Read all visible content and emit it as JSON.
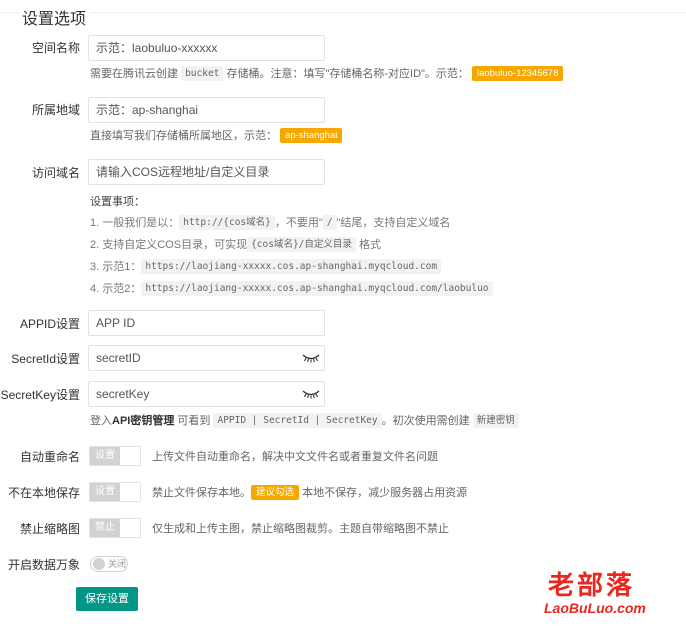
{
  "header": {
    "title": "设置选项"
  },
  "fields": {
    "space_name": {
      "label": "空间名称",
      "placeholder": "示范：laobuluo-xxxxxx",
      "hint_before": "需要在腾讯云创建",
      "hint_code": "bucket",
      "hint_after": "存储桶。注意：填写\"存储桶名称-对应ID\"。示范：",
      "hint_badge": "laobuluo-12345678"
    },
    "region": {
      "label": "所属地域",
      "placeholder": "示范：ap-shanghai",
      "hint_before": "直接填写我们存储桶所属地区，示范：",
      "hint_badge": "ap-shanghai"
    },
    "domain": {
      "label": "访问域名",
      "placeholder": "请输入COS远程地址/自定义目录"
    },
    "appid": {
      "label": "APPID设置",
      "placeholder": "APP ID"
    },
    "secret_id": {
      "label": "SecretId设置",
      "placeholder": "secretID"
    },
    "secret_key": {
      "label": "SecretKey设置",
      "placeholder": "secretKey",
      "hint_before": "登入",
      "hint_link": "API密钥管理",
      "hint_middle": "可看到",
      "hint_code": "APPID | SecretId | SecretKey",
      "hint_after": "。初次使用需创建",
      "hint_code2": "新建密钥"
    }
  },
  "notes": {
    "title": "设置事项：",
    "items": [
      {
        "prefix": "1. 一般我们是以：",
        "code": "http://{cos域名}",
        "middle": "，不要用\"",
        "code2": "/",
        "suffix": "\"结尾，支持自定义域名"
      },
      {
        "prefix": "2. 支持自定义COS目录，可实现",
        "code": "{cos域名}/自定义目录",
        "suffix": "格式"
      },
      {
        "prefix": "3. 示范1：",
        "code": "https://laojiang-xxxxx.cos.ap-shanghai.myqcloud.com"
      },
      {
        "prefix": "4. 示范2：",
        "code": "https://laojiang-xxxxx.cos.ap-shanghai.myqcloud.com/laobuluo"
      }
    ]
  },
  "switches": {
    "auto_rename": {
      "label": "自动重命名",
      "value": "设置",
      "desc": "上传文件自动重命名，解决中文文件名或者重复文件名问题"
    },
    "no_local": {
      "label": "不在本地保存",
      "value": "设置",
      "desc_before": "禁止文件保存本地。",
      "badge": "建议勾选",
      "desc_after": "本地不保存，减少服务器占用资源"
    },
    "no_thumb": {
      "label": "禁止缩略图",
      "value": "禁止",
      "desc": "仅生成和上传主图，禁止缩略图裁剪。主题自带缩略图不禁止"
    }
  },
  "data_wanxiang": {
    "label": "开启数据万象",
    "state": "关闭"
  },
  "save_button": {
    "label": "保存设置"
  },
  "watermark": {
    "cn": "老部落",
    "en": "LaoBuLuo.com"
  },
  "colors": {
    "primary": "#009688",
    "badge": "#f7a800",
    "watermark": "#e8281e"
  }
}
